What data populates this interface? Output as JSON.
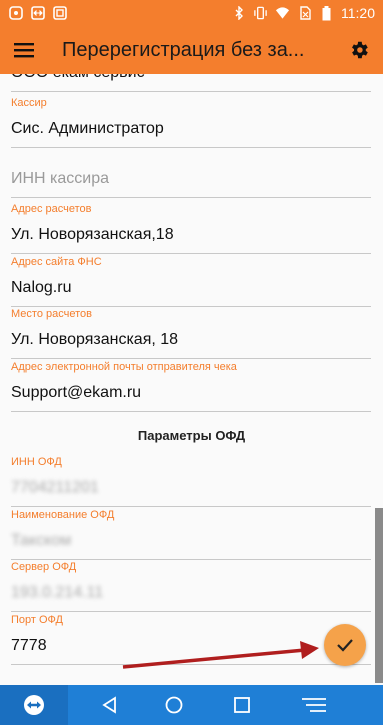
{
  "status_bar": {
    "time": "11:20",
    "icons": [
      "notification-icon",
      "teamviewer-notification-icon",
      "screenshot-icon",
      "bluetooth-icon",
      "vibrate-icon",
      "wifi-icon",
      "no-sim-icon",
      "battery-icon"
    ]
  },
  "app_bar": {
    "title": "Перерегистрация без за..."
  },
  "form": {
    "org_partial": "ООО екам сервис",
    "cashier_label": "Кассир",
    "cashier_value": "Сис. Администратор",
    "cashier_inn_placeholder": "ИНН кассира",
    "payment_address_label": "Адрес расчетов",
    "payment_address_value": "Ул. Новорязанская,18",
    "fns_site_label": "Адрес сайта ФНС",
    "fns_site_value": "Nalog.ru",
    "payment_place_label": "Место расчетов",
    "payment_place_value": "Ул. Новорязанская, 18",
    "sender_email_label": "Адрес электронной почты отправителя чека",
    "sender_email_value": "Support@ekam.ru",
    "ofd_section_title": "Параметры ОФД",
    "ofd_inn_label": "ИНН ОФД",
    "ofd_inn_value": "7704211201",
    "ofd_name_label": "Наименование ОФД",
    "ofd_name_value": "Такском",
    "ofd_server_label": "Сервер ОФД",
    "ofd_server_value": "193.0.214.11",
    "ofd_port_label": "Порт ОФД",
    "ofd_port_value": "7778"
  },
  "colors": {
    "accent": "#f47e2d",
    "nav_bar": "#1f7fd6",
    "fab": "#f5a24a",
    "annotation_arrow": "#b01e1e"
  }
}
